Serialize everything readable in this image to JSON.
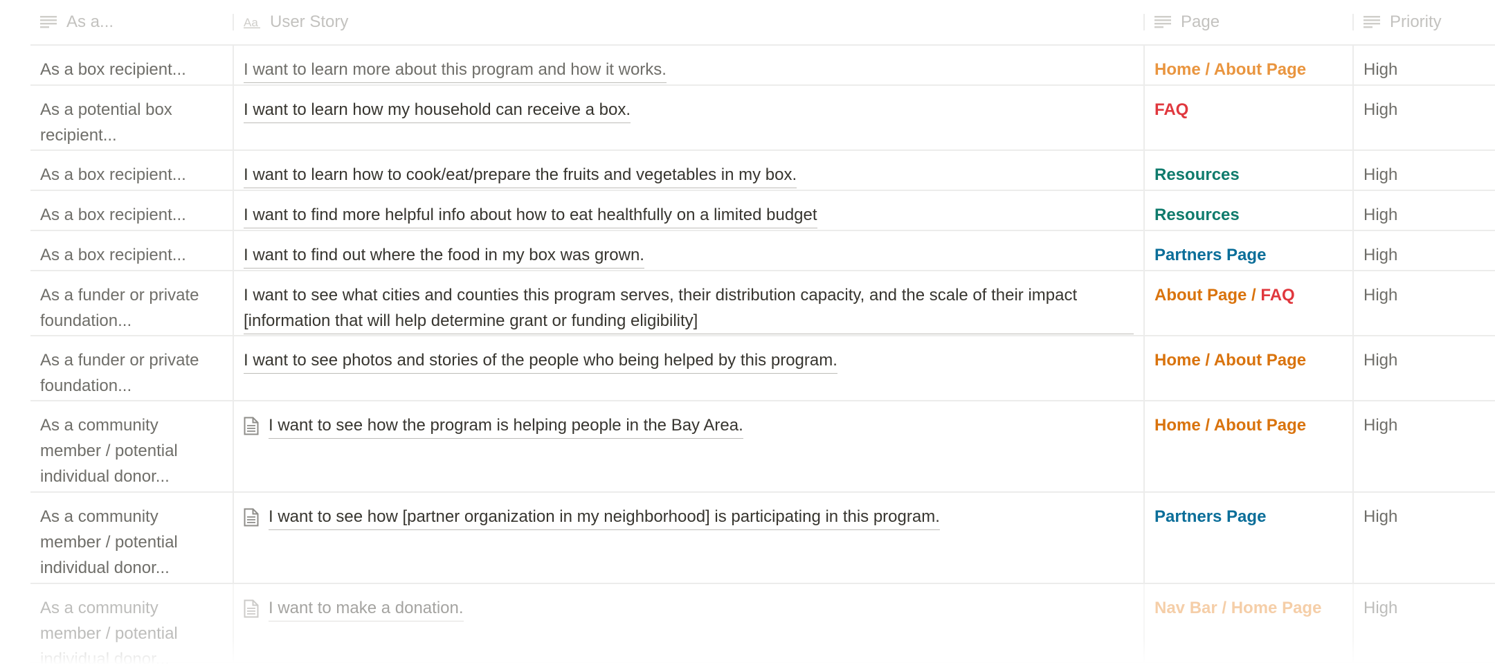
{
  "header": {
    "col_as": "As a...",
    "col_story": "User Story",
    "col_page": "Page",
    "col_priority": "Priority",
    "icons": [
      "text-lines-icon",
      "title-aa-icon",
      "text-lines-icon",
      "text-lines-icon"
    ]
  },
  "rows": [
    {
      "as": "As a box recipient...",
      "story": "I want to learn more about this program and how it works.",
      "has_doc": false,
      "page": [
        {
          "text": "Home / About Page",
          "color": "#e9953f"
        }
      ],
      "priority": "High"
    },
    {
      "as": "As a potential box recipient...",
      "story": "I want to learn how my household can receive a box.",
      "has_doc": false,
      "page": [
        {
          "text": "FAQ",
          "color": "#e0383e"
        }
      ],
      "priority": "High"
    },
    {
      "as": "As a box recipient...",
      "story": "I want to learn how to cook/eat/prepare the fruits and vegetables in my box.",
      "has_doc": false,
      "page": [
        {
          "text": "Resources",
          "color": "#0f7b6c"
        }
      ],
      "priority": "High"
    },
    {
      "as": "As a box recipient...",
      "story": "I want to find more helpful info about how to eat healthfully on a limited budget",
      "has_doc": false,
      "page": [
        {
          "text": "Resources",
          "color": "#0f7b6c"
        }
      ],
      "priority": "High"
    },
    {
      "as": "As a box recipient...",
      "story": "I want to find out where the food in my box was grown.",
      "has_doc": false,
      "page": [
        {
          "text": "Partners Page",
          "color": "#0b6e99"
        }
      ],
      "priority": "High"
    },
    {
      "as": "As a funder or private foundation...",
      "story": "I want to see what cities and counties this program serves, their distribution capacity, and the scale of their impact [information that will help determine grant or funding eligibility]",
      "has_doc": false,
      "page": [
        {
          "text": "About Page",
          "color": "#d9730d"
        },
        {
          "text": " / ",
          "color": "#d9730d"
        },
        {
          "text": "FAQ",
          "color": "#e0383e"
        }
      ],
      "priority": "High"
    },
    {
      "as": "As a funder or private foundation...",
      "story": "I want to see photos and stories of the people who being helped by this program.",
      "has_doc": false,
      "page": [
        {
          "text": "Home / About Page",
          "color": "#d9730d"
        }
      ],
      "priority": "High"
    },
    {
      "as": "As a community member / potential individual donor...",
      "story": "I want to see how the program is helping people in the Bay Area.",
      "has_doc": true,
      "page": [
        {
          "text": "Home / About Page",
          "color": "#d9730d"
        }
      ],
      "priority": "High"
    },
    {
      "as": "As a community member / potential individual donor...",
      "story": "I want to see how [partner organization in my neighborhood] is participating in this program.",
      "has_doc": true,
      "page": [
        {
          "text": "Partners Page",
          "color": "#0b6e99"
        }
      ],
      "priority": "High"
    },
    {
      "as": "As a community member / potential individual donor...",
      "story": "I want to make a donation.",
      "has_doc": true,
      "page": [
        {
          "text": "Nav Bar / Home Page",
          "color": "#e9953f"
        }
      ],
      "priority": "High"
    }
  ]
}
